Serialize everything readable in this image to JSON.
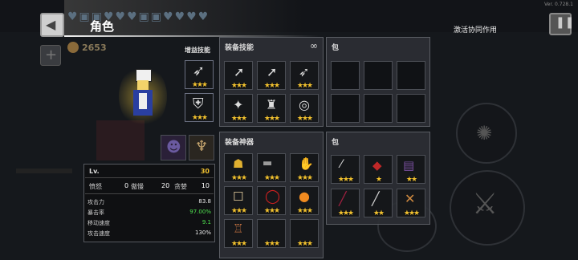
{
  "version": "Ver. 0.728.1",
  "header": {
    "title": "角色",
    "coins": "2653",
    "synergy_label": "激活协同作用"
  },
  "character": {
    "buff_skills_label": "增益技能",
    "buff_skill_stars": [
      "★★★",
      "★★★"
    ]
  },
  "equip_skills": {
    "title": "装备技能",
    "stars": [
      "★★★",
      "★★★",
      "★★★",
      "★★★",
      "★★★",
      "★★★"
    ]
  },
  "skill_bag": {
    "title": "包"
  },
  "equip_artifacts": {
    "title": "装备神器",
    "stars": [
      "★★★",
      "★★★",
      "★★★",
      "★★★",
      "★★★",
      "★★★",
      "★★★",
      "★★★",
      "★★★",
      "★★★"
    ]
  },
  "artifact_bag": {
    "title": "包",
    "stars": [
      "★★★",
      "★",
      "★★",
      "★★★",
      "★★",
      "★★★"
    ]
  },
  "stats": {
    "level_label": "Lv.",
    "level_value": "30",
    "traits": [
      {
        "label": "愤怒",
        "value": "0"
      },
      {
        "label": "傲慢",
        "value": ""
      },
      {
        "label": "20",
        "value": ""
      },
      {
        "label": "贪婪",
        "value": "10"
      }
    ],
    "rows": [
      {
        "label": "攻击力",
        "value": "83.8",
        "color": "#e8e8e8"
      },
      {
        "label": "暴击率",
        "value": "97.00%",
        "color": "#4ee04e"
      },
      {
        "label": "移动速度",
        "value": "9.1",
        "color": "#4ee04e"
      },
      {
        "label": "攻击速度",
        "value": "130%",
        "color": "#e8e8e8"
      }
    ]
  },
  "colors": {
    "star": "#f2c230",
    "green": "#4ee04e",
    "gold": "#f2c230"
  }
}
